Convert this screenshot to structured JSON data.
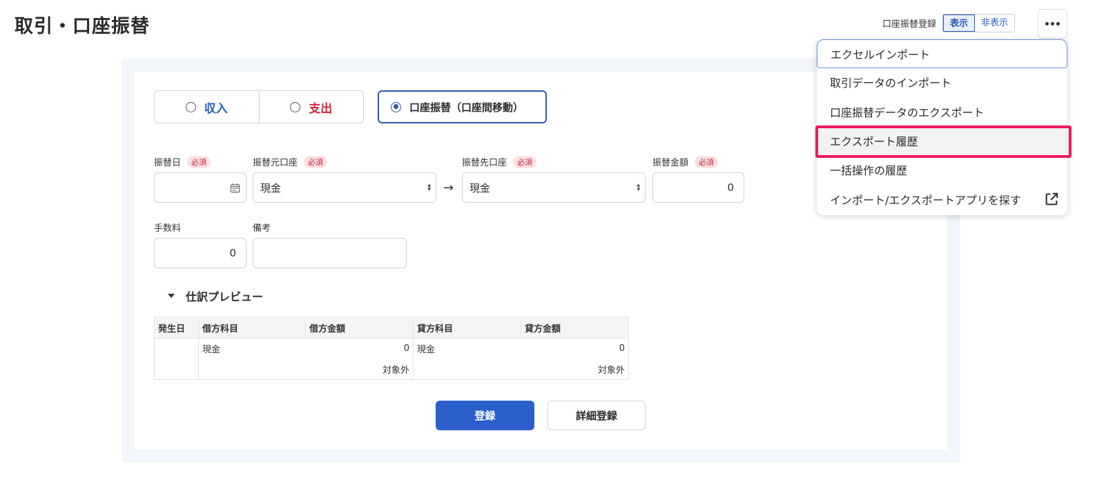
{
  "page": {
    "title": "取引・口座振替"
  },
  "header": {
    "toggle_label": "口座振替登録",
    "show_label": "表示",
    "hide_label": "非表示",
    "more_icon": "more-horizontal-icon"
  },
  "form": {
    "type_income": "収入",
    "type_expense": "支出",
    "type_transfer": "口座振替（口座間移動）",
    "transfer_date_label": "振替日",
    "from_account_label": "振替元口座",
    "to_account_label": "振替先口座",
    "amount_label": "振替金額",
    "required_badge": "必須",
    "from_account_value": "現金",
    "to_account_value": "現金",
    "amount_value": "0",
    "fee_label": "手数料",
    "fee_value": "0",
    "memo_label": "備考",
    "memo_value": ""
  },
  "preview": {
    "title": "仕訳プレビュー",
    "columns": [
      "発生日",
      "借方科目",
      "借方金額",
      "貸方科目",
      "貸方金額"
    ],
    "row": {
      "date": "",
      "debit_account": "現金",
      "debit_amount": "0",
      "credit_account": "現金",
      "credit_amount": "0",
      "debit_note": "対象外",
      "credit_note": "対象外"
    }
  },
  "actions": {
    "register": "登録",
    "detail_register": "詳細登録"
  },
  "menu": {
    "items": [
      "エクセルインポート",
      "取引データのインポート",
      "口座振替データのエクスポート",
      "エクスポート履歴",
      "一括操作の履歴",
      "インポート/エクスポートアプリを探す"
    ],
    "highlight_color": "#f0185e"
  },
  "colors": {
    "accent": "#2b56b3",
    "income": "#2360c6",
    "expense": "#d6263c",
    "primary_button": "#2b5fc9"
  }
}
